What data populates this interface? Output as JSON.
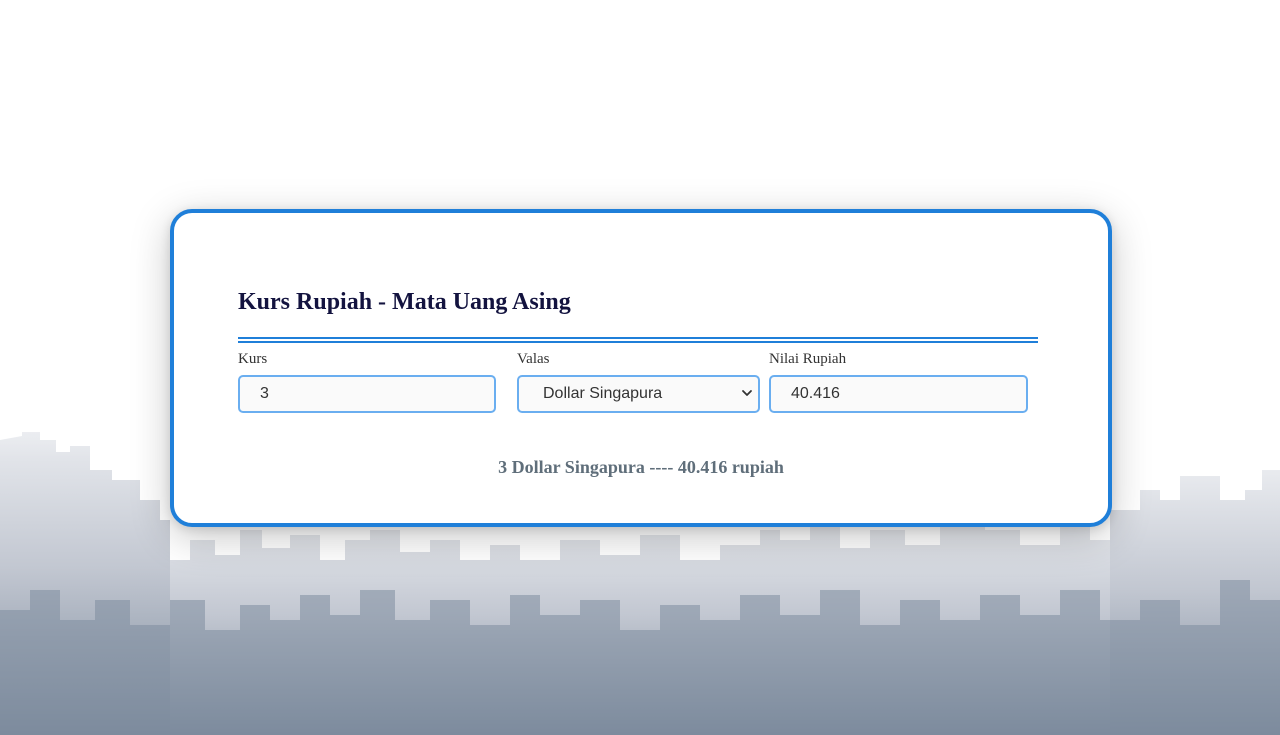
{
  "page": {
    "title": "Kurs Rupiah - Mata Uang Asing"
  },
  "form": {
    "kurs": {
      "label": "Kurs",
      "value": "3"
    },
    "valas": {
      "label": "Valas",
      "selected": "Dollar Singapura"
    },
    "nilai": {
      "label": "Nilai Rupiah",
      "value": "40.416"
    }
  },
  "result": {
    "text": "3 Dollar Singapura ---- 40.416 rupiah"
  },
  "colors": {
    "accent": "#1f7fd9",
    "input_border": "#6aaef0",
    "title": "#13133f",
    "result": "#5f6e7a"
  },
  "icons": {
    "select": "chevron-down-icon"
  }
}
